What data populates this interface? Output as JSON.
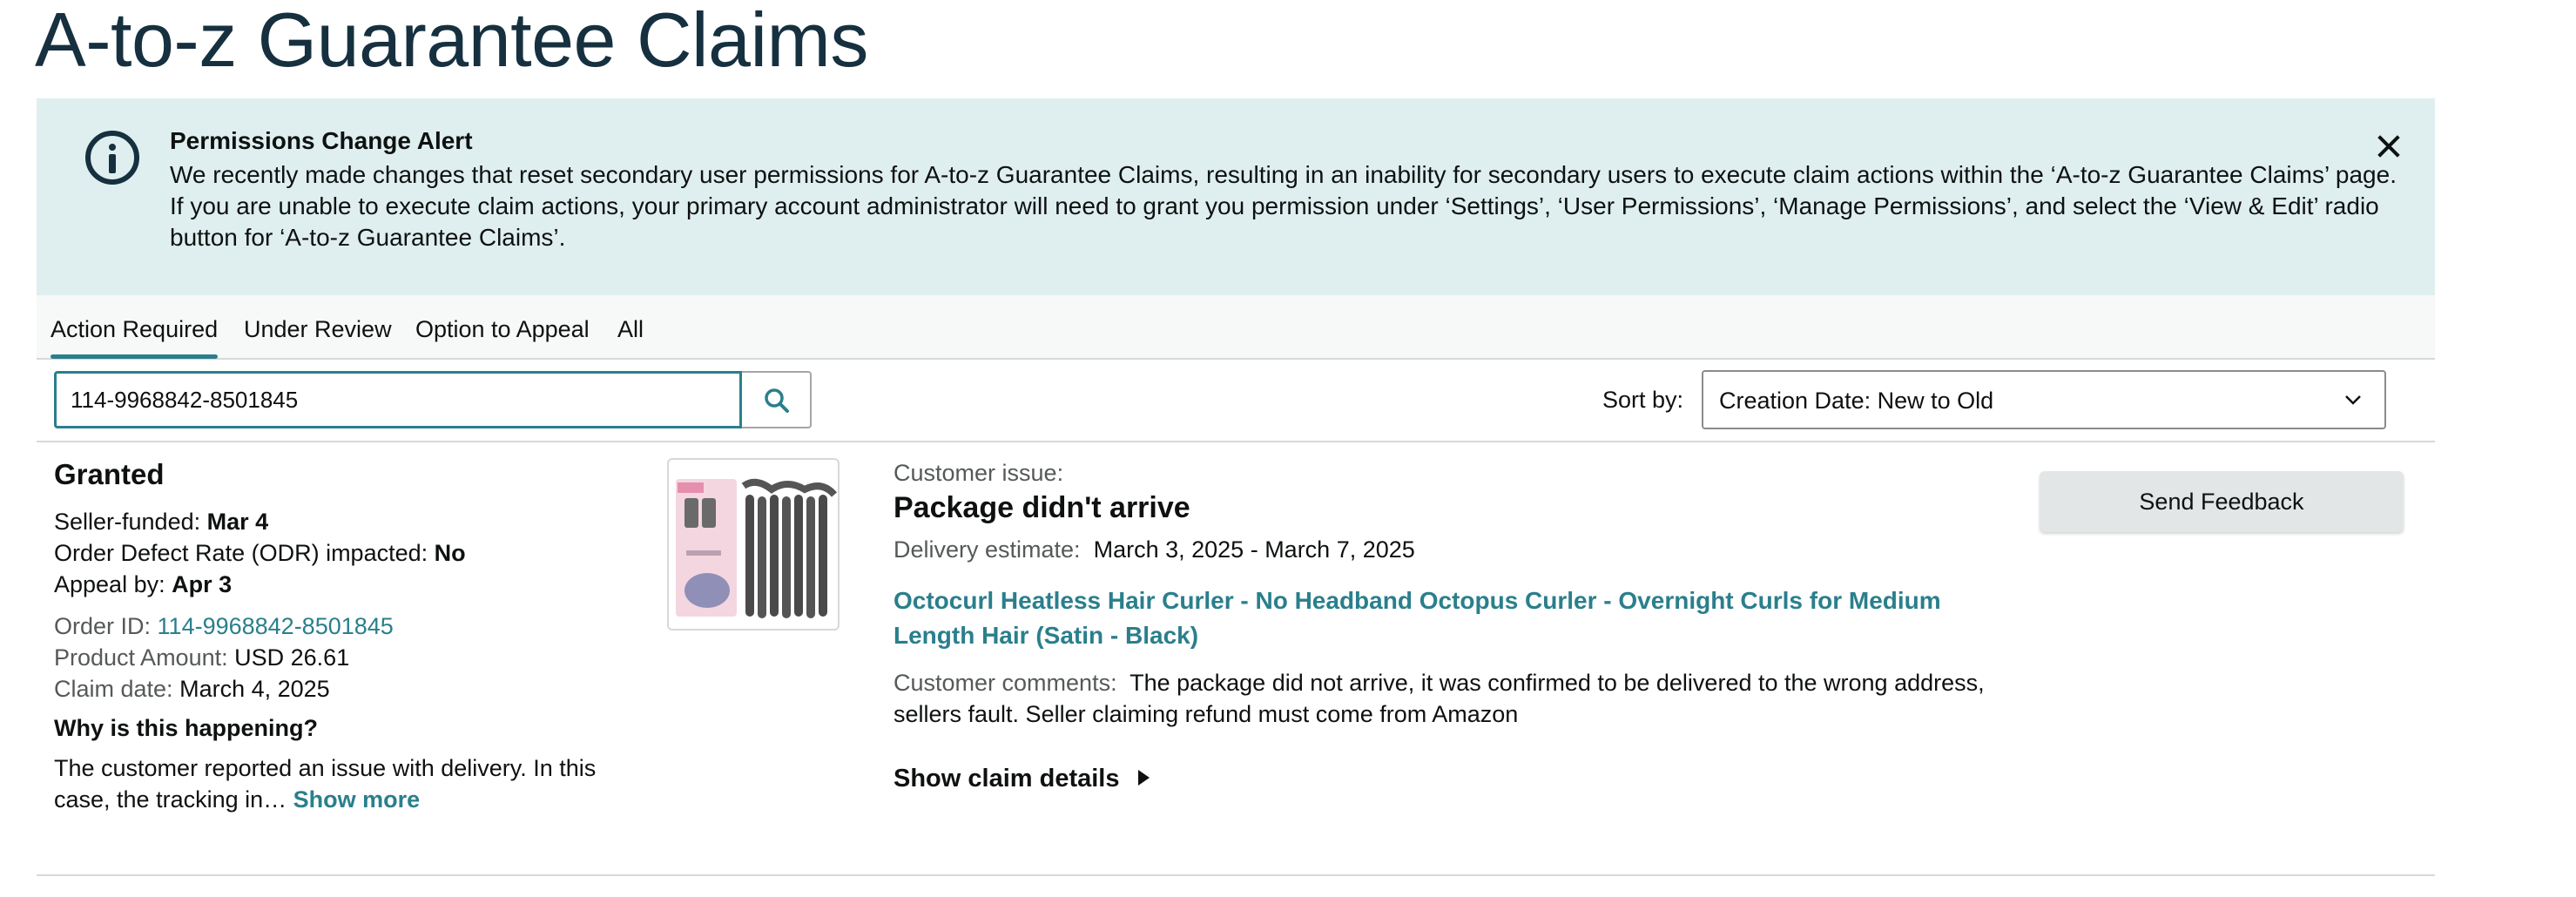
{
  "page": {
    "title": "A-to-z Guarantee Claims"
  },
  "alert": {
    "title": "Permissions Change Alert",
    "body": "We recently made changes that reset secondary user permissions for A-to-z Guarantee Claims, resulting in an inability for secondary users to execute claim actions within the ‘A-to-z Guarantee Claims’ page. If you are unable to execute claim actions, your primary account administrator will need to grant you permission under ‘Settings’, ‘User Permissions’, ‘Manage Permissions’, and select the ‘View & Edit’ radio button for ‘A-to-z Guarantee Claims’."
  },
  "tabs": [
    {
      "label": "Action Required",
      "active": true
    },
    {
      "label": "Under Review",
      "active": false
    },
    {
      "label": "Option to Appeal",
      "active": false
    },
    {
      "label": "All",
      "active": false
    }
  ],
  "search": {
    "value": "114-9968842-8501845"
  },
  "sort": {
    "label": "Sort by:",
    "value": "Creation Date: New to Old"
  },
  "claim": {
    "status": "Granted",
    "seller_funded_label": "Seller-funded:",
    "seller_funded_value": "Mar 4",
    "odr_label": "Order Defect Rate (ODR) impacted:",
    "odr_value": "No",
    "appeal_label": "Appeal by:",
    "appeal_value": "Apr 3",
    "order_id_label": "Order ID:",
    "order_id_value": "114-9968842-8501845",
    "amount_label": "Product Amount:",
    "amount_value": "USD 26.61",
    "claim_date_label": "Claim date:",
    "claim_date_value": "March 4, 2025",
    "why_heading": "Why is this happening?",
    "why_text": "The customer reported an issue with delivery. In this case, the tracking in…",
    "show_more": "Show more",
    "issue_label": "Customer issue:",
    "issue_title": "Package didn't arrive",
    "delivery_label": "Delivery estimate:",
    "delivery_value": "March 3, 2025 - March 7, 2025",
    "product_title": "Octocurl Heatless Hair Curler - No Headband Octopus Curler - Overnight Curls for Medium Length Hair (Satin - Black)",
    "comments_label": "Customer comments:",
    "comments_value": "The package did not arrive, it was confirmed to be delivered to the wrong address, sellers fault. Seller claiming refund must come from Amazon",
    "show_details": "Show claim details",
    "feedback_button": "Send Feedback"
  },
  "icons": {
    "alert": "info-icon",
    "close": "close-icon",
    "search": "search-icon",
    "sort": "chevron-down-icon",
    "details": "play-icon"
  },
  "colors": {
    "accent": "#2a7f8c",
    "alert_bg": "#dfeff0",
    "title": "#16303f",
    "button_bg": "#e3e6e6"
  }
}
